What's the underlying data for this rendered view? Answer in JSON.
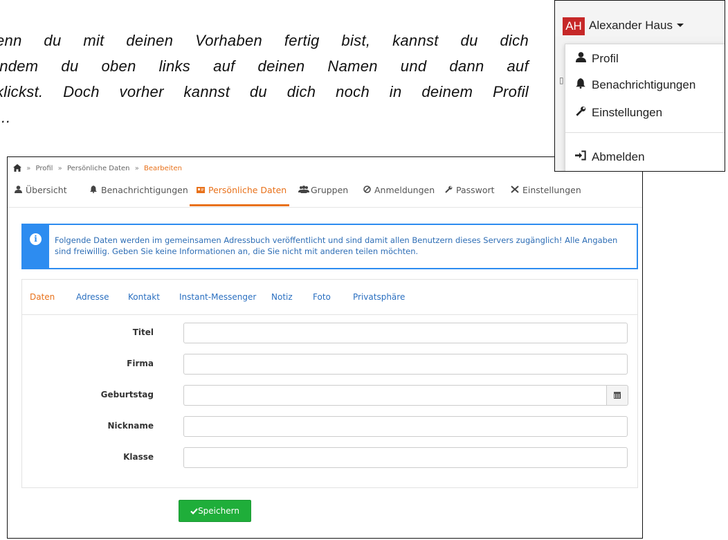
{
  "instruction": {
    "lines": [
      "enn du mit deinen Vorhaben fertig bist, kannst du dich",
      "indem du oben links auf deinen Namen und dann auf",
      "klickst. Doch vorher kannst du dich noch in deinem Profil",
      "…"
    ]
  },
  "breadcrumb": {
    "items": [
      "Profil",
      "Persönliche Daten"
    ],
    "active": "Bearbeiten",
    "separator": "»"
  },
  "nav": {
    "items": [
      {
        "label": "Übersicht",
        "icon": "user-icon"
      },
      {
        "label": "Benachrichtigungen",
        "icon": "bell-icon"
      },
      {
        "label": "Persönliche Daten",
        "icon": "id-card-icon"
      },
      {
        "label": "Gruppen",
        "icon": "group-icon"
      },
      {
        "label": "Anmeldungen",
        "icon": "login-icon"
      },
      {
        "label": "Passwort",
        "icon": "wrench-icon"
      },
      {
        "label": "Einstellungen",
        "icon": "tools-icon"
      }
    ],
    "active": "Persönliche Daten"
  },
  "alert": {
    "icon": "info-icon",
    "text": "Folgende Daten werden im gemeinsamen Adressbuch veröffentlicht und sind damit allen Benutzern dieses Servers zugänglich! Alle Angaben sind freiwillig. Geben Sie keine Informationen an, die Sie nicht mit anderen teilen möchten."
  },
  "tabs": [
    "Daten",
    "Adresse",
    "Kontakt",
    "Instant-Messenger",
    "Notiz",
    "Foto",
    "Privatsphäre"
  ],
  "form": {
    "fields": [
      {
        "label": "Titel",
        "value": ""
      },
      {
        "label": "Firma",
        "value": ""
      },
      {
        "label": "Geburtstag",
        "value": ""
      },
      {
        "label": "Nickname",
        "value": ""
      },
      {
        "label": "Klasse",
        "value": ""
      }
    ],
    "save_label": "Speichern"
  },
  "user_menu": {
    "initials": "AH",
    "name": "Alexander Haus",
    "items": [
      {
        "label": "Profil",
        "icon": "user-icon"
      },
      {
        "label": "Benachrichtigungen",
        "icon": "bell-icon"
      },
      {
        "label": "Einstellungen",
        "icon": "wrench-icon"
      },
      {
        "label": "Abmelden",
        "icon": "logout-icon"
      }
    ]
  },
  "colors": {
    "accent": "#e8711a",
    "info": "#2d8cf0",
    "link": "#2a6fc0",
    "success": "#1fae3a",
    "avatar": "#c62828"
  }
}
